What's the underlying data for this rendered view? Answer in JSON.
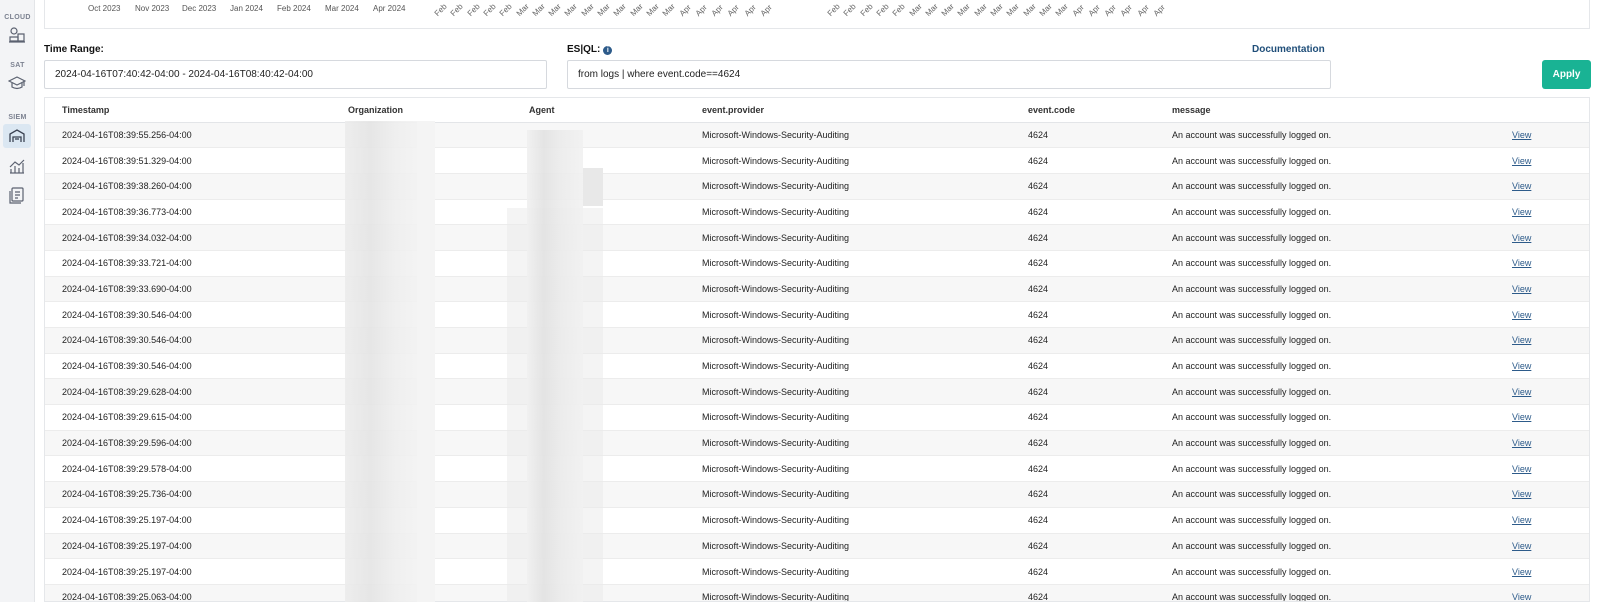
{
  "sidebar": {
    "sections": [
      {
        "label": "CLOUD",
        "icon": "cloud-resources-icon"
      },
      {
        "label": "SAT",
        "icon": "graduation-cap-icon"
      },
      {
        "label": "SIEM",
        "icon": "siem-dashboard-icon"
      }
    ],
    "extra_icons": [
      "analytics-chart-icon",
      "reports-icon"
    ],
    "active": "siem-dashboard-icon"
  },
  "chart_strip": {
    "month_ticks": [
      "Oct 2023",
      "Nov 2023",
      "Dec 2023",
      "Jan 2024",
      "Feb 2024",
      "Mar 2024",
      "Apr 2024"
    ],
    "rotated_ticks_a": [
      "Feb",
      "Feb",
      "Feb",
      "Feb",
      "Feb",
      "Mar",
      "Mar",
      "Mar",
      "Mar",
      "Mar",
      "Mar",
      "Mar",
      "Mar",
      "Mar",
      "Mar",
      "Apr",
      "Apr",
      "Apr",
      "Apr",
      "Apr",
      "Apr"
    ],
    "rotated_ticks_b": [
      "Feb",
      "Feb",
      "Feb",
      "Feb",
      "Feb",
      "Mar",
      "Mar",
      "Mar",
      "Mar",
      "Mar",
      "Mar",
      "Mar",
      "Mar",
      "Mar",
      "Mar",
      "Apr",
      "Apr",
      "Apr",
      "Apr",
      "Apr",
      "Apr"
    ]
  },
  "filters": {
    "time_range_label": "Time Range:",
    "time_range_value": "2024-04-16T07:40:42-04:00 - 2024-04-16T08:40:42-04:00",
    "esql_label": "ES|QL:",
    "esql_value": "from logs | where event.code==4624",
    "documentation_link": "Documentation",
    "apply_button": "Apply"
  },
  "table": {
    "columns": [
      "Timestamp",
      "Organization",
      "Agent",
      "event.provider",
      "event.code",
      "message"
    ],
    "rows": [
      {
        "timestamp": "2024-04-16T08:39:55.256-04:00",
        "provider": "Microsoft-Windows-Security-Auditing",
        "code": "4624",
        "message": "An account was successfully logged on.",
        "action": "View"
      },
      {
        "timestamp": "2024-04-16T08:39:51.329-04:00",
        "provider": "Microsoft-Windows-Security-Auditing",
        "code": "4624",
        "message": "An account was successfully logged on.",
        "action": "View"
      },
      {
        "timestamp": "2024-04-16T08:39:38.260-04:00",
        "provider": "Microsoft-Windows-Security-Auditing",
        "code": "4624",
        "message": "An account was successfully logged on.",
        "action": "View"
      },
      {
        "timestamp": "2024-04-16T08:39:36.773-04:00",
        "provider": "Microsoft-Windows-Security-Auditing",
        "code": "4624",
        "message": "An account was successfully logged on.",
        "action": "View"
      },
      {
        "timestamp": "2024-04-16T08:39:34.032-04:00",
        "provider": "Microsoft-Windows-Security-Auditing",
        "code": "4624",
        "message": "An account was successfully logged on.",
        "action": "View"
      },
      {
        "timestamp": "2024-04-16T08:39:33.721-04:00",
        "provider": "Microsoft-Windows-Security-Auditing",
        "code": "4624",
        "message": "An account was successfully logged on.",
        "action": "View"
      },
      {
        "timestamp": "2024-04-16T08:39:33.690-04:00",
        "provider": "Microsoft-Windows-Security-Auditing",
        "code": "4624",
        "message": "An account was successfully logged on.",
        "action": "View"
      },
      {
        "timestamp": "2024-04-16T08:39:30.546-04:00",
        "provider": "Microsoft-Windows-Security-Auditing",
        "code": "4624",
        "message": "An account was successfully logged on.",
        "action": "View"
      },
      {
        "timestamp": "2024-04-16T08:39:30.546-04:00",
        "provider": "Microsoft-Windows-Security-Auditing",
        "code": "4624",
        "message": "An account was successfully logged on.",
        "action": "View"
      },
      {
        "timestamp": "2024-04-16T08:39:30.546-04:00",
        "provider": "Microsoft-Windows-Security-Auditing",
        "code": "4624",
        "message": "An account was successfully logged on.",
        "action": "View"
      },
      {
        "timestamp": "2024-04-16T08:39:29.628-04:00",
        "provider": "Microsoft-Windows-Security-Auditing",
        "code": "4624",
        "message": "An account was successfully logged on.",
        "action": "View"
      },
      {
        "timestamp": "2024-04-16T08:39:29.615-04:00",
        "provider": "Microsoft-Windows-Security-Auditing",
        "code": "4624",
        "message": "An account was successfully logged on.",
        "action": "View"
      },
      {
        "timestamp": "2024-04-16T08:39:29.596-04:00",
        "provider": "Microsoft-Windows-Security-Auditing",
        "code": "4624",
        "message": "An account was successfully logged on.",
        "action": "View"
      },
      {
        "timestamp": "2024-04-16T08:39:29.578-04:00",
        "provider": "Microsoft-Windows-Security-Auditing",
        "code": "4624",
        "message": "An account was successfully logged on.",
        "action": "View"
      },
      {
        "timestamp": "2024-04-16T08:39:25.736-04:00",
        "provider": "Microsoft-Windows-Security-Auditing",
        "code": "4624",
        "message": "An account was successfully logged on.",
        "action": "View"
      },
      {
        "timestamp": "2024-04-16T08:39:25.197-04:00",
        "provider": "Microsoft-Windows-Security-Auditing",
        "code": "4624",
        "message": "An account was successfully logged on.",
        "action": "View"
      },
      {
        "timestamp": "2024-04-16T08:39:25.197-04:00",
        "provider": "Microsoft-Windows-Security-Auditing",
        "code": "4624",
        "message": "An account was successfully logged on.",
        "action": "View"
      },
      {
        "timestamp": "2024-04-16T08:39:25.197-04:00",
        "provider": "Microsoft-Windows-Security-Auditing",
        "code": "4624",
        "message": "An account was successfully logged on.",
        "action": "View"
      },
      {
        "timestamp": "2024-04-16T08:39:25.063-04:00",
        "provider": "Microsoft-Windows-Security-Auditing",
        "code": "4624",
        "message": "An account was successfully logged on.",
        "action": "View"
      }
    ]
  },
  "colors": {
    "accent": "#19b394",
    "link": "#2d5b8a",
    "doc_link": "#1f4e79",
    "active_nav_bg": "#dbe7f2"
  }
}
